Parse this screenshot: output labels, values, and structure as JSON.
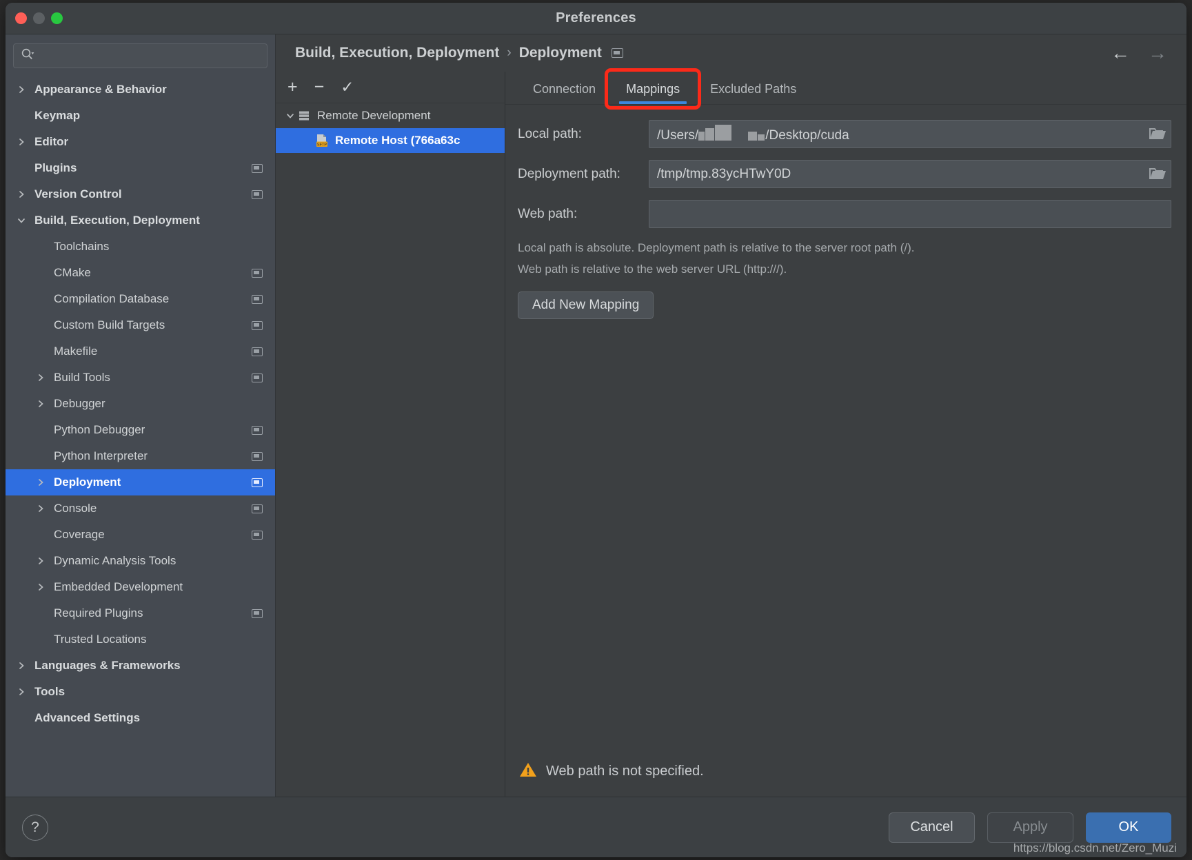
{
  "window": {
    "title": "Preferences",
    "traffic_lights": [
      "close",
      "minimize",
      "zoom"
    ]
  },
  "sidebar": {
    "search": {
      "value": "",
      "placeholder": ""
    },
    "items": [
      {
        "label": "Appearance & Behavior",
        "indent": 0,
        "twisty": "right",
        "bold": true,
        "badge": false,
        "selected": false
      },
      {
        "label": "Keymap",
        "indent": 0,
        "twisty": "none",
        "bold": true,
        "badge": false,
        "selected": false
      },
      {
        "label": "Editor",
        "indent": 0,
        "twisty": "right",
        "bold": true,
        "badge": false,
        "selected": false
      },
      {
        "label": "Plugins",
        "indent": 0,
        "twisty": "none",
        "bold": true,
        "badge": true,
        "selected": false
      },
      {
        "label": "Version Control",
        "indent": 0,
        "twisty": "right",
        "bold": true,
        "badge": true,
        "selected": false
      },
      {
        "label": "Build, Execution, Deployment",
        "indent": 0,
        "twisty": "down",
        "bold": true,
        "badge": false,
        "selected": false
      },
      {
        "label": "Toolchains",
        "indent": 1,
        "twisty": "none",
        "bold": false,
        "badge": false,
        "selected": false
      },
      {
        "label": "CMake",
        "indent": 1,
        "twisty": "none",
        "bold": false,
        "badge": true,
        "selected": false
      },
      {
        "label": "Compilation Database",
        "indent": 1,
        "twisty": "none",
        "bold": false,
        "badge": true,
        "selected": false
      },
      {
        "label": "Custom Build Targets",
        "indent": 1,
        "twisty": "none",
        "bold": false,
        "badge": true,
        "selected": false
      },
      {
        "label": "Makefile",
        "indent": 1,
        "twisty": "none",
        "bold": false,
        "badge": true,
        "selected": false
      },
      {
        "label": "Build Tools",
        "indent": 1,
        "twisty": "right",
        "bold": false,
        "badge": true,
        "selected": false
      },
      {
        "label": "Debugger",
        "indent": 1,
        "twisty": "right",
        "bold": false,
        "badge": false,
        "selected": false
      },
      {
        "label": "Python Debugger",
        "indent": 1,
        "twisty": "none",
        "bold": false,
        "badge": true,
        "selected": false
      },
      {
        "label": "Python Interpreter",
        "indent": 1,
        "twisty": "none",
        "bold": false,
        "badge": true,
        "selected": false
      },
      {
        "label": "Deployment",
        "indent": 1,
        "twisty": "right",
        "bold": false,
        "badge": true,
        "selected": true
      },
      {
        "label": "Console",
        "indent": 1,
        "twisty": "right",
        "bold": false,
        "badge": true,
        "selected": false
      },
      {
        "label": "Coverage",
        "indent": 1,
        "twisty": "none",
        "bold": false,
        "badge": true,
        "selected": false
      },
      {
        "label": "Dynamic Analysis Tools",
        "indent": 1,
        "twisty": "right",
        "bold": false,
        "badge": false,
        "selected": false
      },
      {
        "label": "Embedded Development",
        "indent": 1,
        "twisty": "right",
        "bold": false,
        "badge": false,
        "selected": false
      },
      {
        "label": "Required Plugins",
        "indent": 1,
        "twisty": "none",
        "bold": false,
        "badge": true,
        "selected": false
      },
      {
        "label": "Trusted Locations",
        "indent": 1,
        "twisty": "none",
        "bold": false,
        "badge": false,
        "selected": false
      },
      {
        "label": "Languages & Frameworks",
        "indent": 0,
        "twisty": "right",
        "bold": true,
        "badge": false,
        "selected": false
      },
      {
        "label": "Tools",
        "indent": 0,
        "twisty": "right",
        "bold": true,
        "badge": false,
        "selected": false
      },
      {
        "label": "Advanced Settings",
        "indent": 0,
        "twisty": "none",
        "bold": true,
        "badge": false,
        "selected": false
      }
    ]
  },
  "breadcrumb": {
    "root": "Build, Execution, Deployment",
    "separator": "›",
    "leaf": "Deployment",
    "back_arrow": "←",
    "forward_arrow": "→"
  },
  "servers": {
    "toolbar": {
      "add": "+",
      "remove": "−",
      "set_default": "✓"
    },
    "nodes": [
      {
        "label": "Remote Development",
        "twisty": "down",
        "icon": "server-group-icon",
        "indent": 0,
        "selected": false
      },
      {
        "label": "Remote Host (766a63c",
        "twisty": "none",
        "icon": "sftp-server-icon",
        "indent": 1,
        "selected": true
      }
    ]
  },
  "tabs": [
    {
      "label": "Connection",
      "active": false,
      "highlighted": false
    },
    {
      "label": "Mappings",
      "active": true,
      "highlighted": true
    },
    {
      "label": "Excluded Paths",
      "active": false,
      "highlighted": false
    }
  ],
  "mappings_form": {
    "local_path": {
      "label": "Local path:",
      "prefix": "/Users/",
      "redacted": true,
      "suffix": "/Desktop/cuda",
      "browse_icon": "folder-icon"
    },
    "deployment_path": {
      "label": "Deployment path:",
      "value": "/tmp/tmp.83ycHTwY0D",
      "browse_icon": "folder-icon"
    },
    "web_path": {
      "label": "Web path:",
      "value": "",
      "placeholder": ""
    },
    "hint_line1": "Local path is absolute. Deployment path is relative to the server root path (/).",
    "hint_line2": "Web path is relative to the web server URL (http:///).",
    "add_mapping_button": "Add New Mapping"
  },
  "status": {
    "warning_icon": "warning-triangle-icon",
    "warning_text": "Web path is not specified."
  },
  "footer": {
    "help": "?",
    "cancel": "Cancel",
    "apply": "Apply",
    "ok": "OK"
  },
  "watermark": "https://blog.csdn.net/Zero_Muzi",
  "colors": {
    "accent_blue": "#2f6ee0",
    "tab_underline": "#3d87dd",
    "highlight_red": "#fc2a19",
    "ok_button": "#3a6fb0",
    "warning_amber": "#f2a11c"
  }
}
